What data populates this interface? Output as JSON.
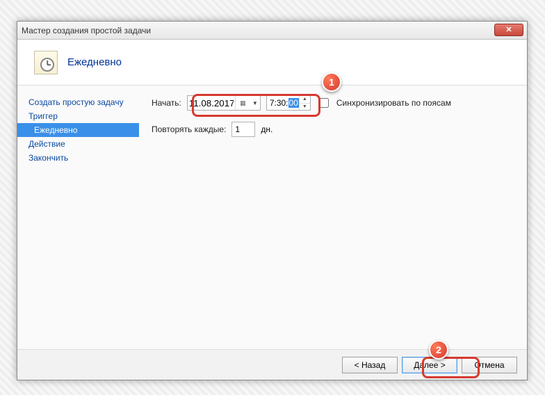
{
  "window": {
    "title": "Мастер создания простой задачи",
    "close_glyph": "✕"
  },
  "header": {
    "heading": "Ежедневно"
  },
  "nav": {
    "items": [
      {
        "label": "Создать простую задачу",
        "selected": false
      },
      {
        "label": "Триггер",
        "selected": false
      },
      {
        "label": "Ежедневно",
        "selected": true
      },
      {
        "label": "Действие",
        "selected": false
      },
      {
        "label": "Закончить",
        "selected": false
      }
    ]
  },
  "form": {
    "start_label": "Начать:",
    "date_value": "11.08.2017",
    "time_prefix": "7:30:",
    "time_selected": "00",
    "sync_label": "Синхронизировать по поясам",
    "repeat_label": "Повторять каждые:",
    "repeat_value": "1",
    "repeat_unit": "дн."
  },
  "footer": {
    "back": "< Назад",
    "next": "Далее >",
    "cancel": "Отмена"
  },
  "annotations": {
    "badge1": "1",
    "badge2": "2"
  }
}
